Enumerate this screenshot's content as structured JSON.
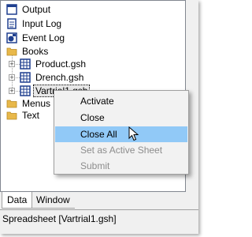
{
  "tree": {
    "items": [
      {
        "label": "Output",
        "icon": "output-window-icon"
      },
      {
        "label": "Input Log",
        "icon": "log-document-icon"
      },
      {
        "label": "Event Log",
        "icon": "event-log-icon"
      },
      {
        "label": "Books",
        "icon": "folder-icon"
      },
      {
        "label": "Product.gsh",
        "icon": "spreadsheet-icon"
      },
      {
        "label": "Drench.gsh",
        "icon": "spreadsheet-icon"
      },
      {
        "label": "Vartrial1.gsh",
        "icon": "spreadsheet-icon"
      },
      {
        "label": "Menus",
        "icon": "folder-icon"
      },
      {
        "label": "Text",
        "icon": "folder-icon"
      }
    ]
  },
  "context_menu": {
    "items": [
      {
        "label": "Activate",
        "enabled": true
      },
      {
        "label": "Close",
        "enabled": true
      },
      {
        "label": "Close All",
        "enabled": true,
        "highlighted": true
      },
      {
        "label": "Set as Active Sheet",
        "enabled": false
      },
      {
        "label": "Submit",
        "enabled": false
      }
    ]
  },
  "tabs": [
    "Data",
    "Window"
  ],
  "status": "Spreadsheet [Vartrial1.gsh]",
  "colors": {
    "menu_highlight": "#91c9f7",
    "disabled_text": "#8d8d8d",
    "folder": "#e8b84a",
    "spreadsheet_icon": "#1f3f8f"
  }
}
